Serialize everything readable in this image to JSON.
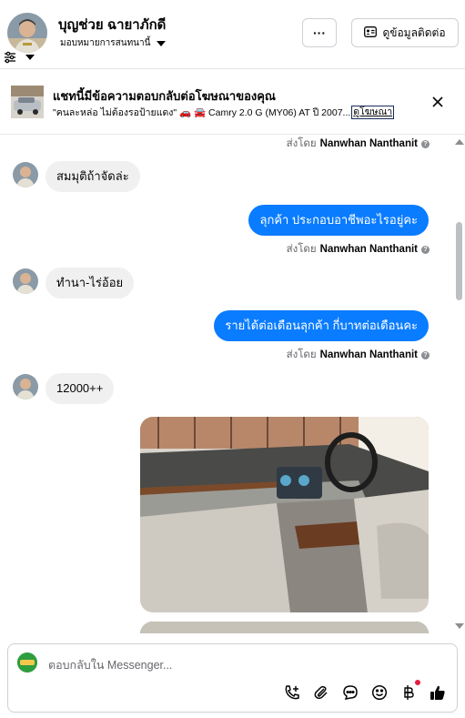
{
  "header": {
    "contact_name": "บุญช่วย ฉายาภักดี",
    "assigned_to": "มอบหมายการสนทนานี้",
    "more_label": "···",
    "view_contact_label": "ดูข้อมูลติดต่อ",
    "icons": [
      "filter-icon",
      "chevron-down-icon",
      "more-icon",
      "contact-card-icon"
    ]
  },
  "ad_banner": {
    "title": "แชทนี้มีข้อความตอบกลับต่อโฆษณาของคุณ",
    "subtitle": "\"คนละหล่อ ไม่ต้องรอป้ายแดง\" 🚗 🚘 Camry 2.0 G (MY06) AT ปี 2007...",
    "link_label": "ดูโฆษณา",
    "close_icon": "close-icon"
  },
  "messages": [
    {
      "type": "sent_by",
      "prefix": "ส่งโดย",
      "sender": "Nanwhan Nanthanit"
    },
    {
      "type": "incoming",
      "text": "สมมุติถ้าจัดล่ะ"
    },
    {
      "type": "outgoing",
      "text": "ลุกค้า ประกอบอาชีพอะไรอยู่คะ"
    },
    {
      "type": "sent_by",
      "prefix": "ส่งโดย",
      "sender": "Nanwhan Nanthanit"
    },
    {
      "type": "incoming",
      "text": "ทำนา-ไร่อ้อย"
    },
    {
      "type": "outgoing",
      "text": "รายได้ต่อเดือนลุกค้า กี่บาทต่อเดือนคะ"
    },
    {
      "type": "sent_by",
      "prefix": "ส่งโดย",
      "sender": "Nanwhan Nanthanit"
    },
    {
      "type": "incoming",
      "text": "12000++"
    },
    {
      "type": "image",
      "alt": "car-interior-photo"
    }
  ],
  "composer": {
    "placeholder": "ตอบกลับใน Messenger...",
    "icons": [
      "call-add-icon",
      "paperclip-icon",
      "message-bubble-icon",
      "emoji-icon",
      "baht-payment-icon",
      "thumbs-up-icon"
    ]
  },
  "colors": {
    "outgoing_bubble": "#0a7cff",
    "incoming_bubble": "#f0f0f0",
    "notification_dot": "#e41e3f"
  }
}
